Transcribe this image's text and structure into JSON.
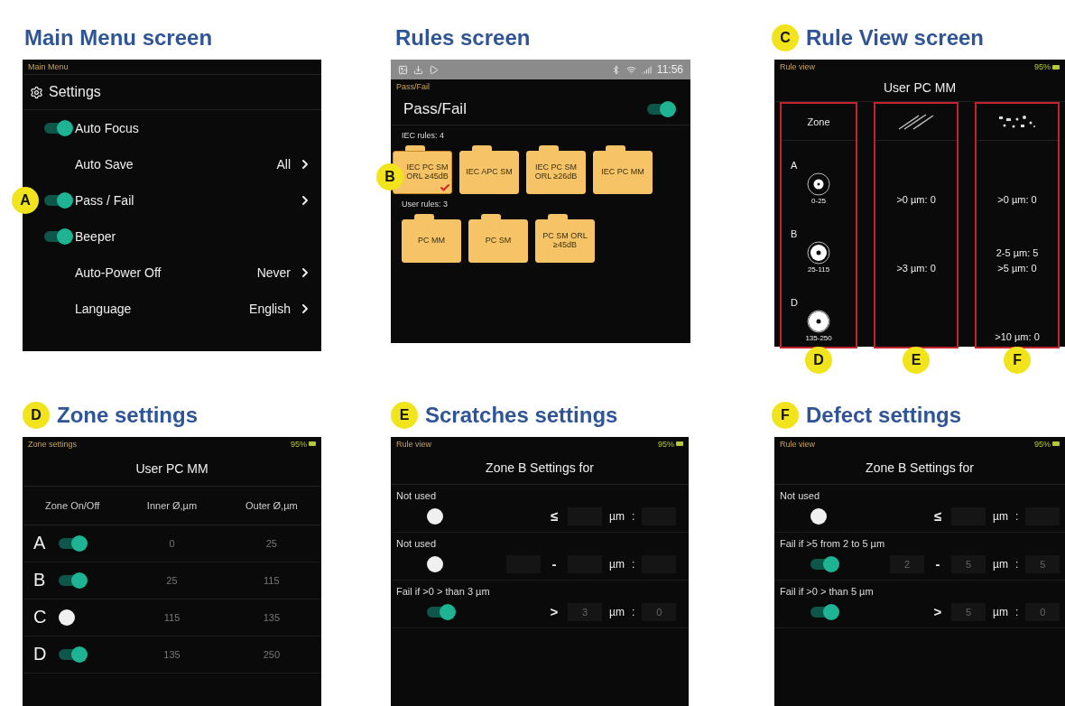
{
  "panels": [
    {
      "kind": "main_menu",
      "heading": "Main Menu screen",
      "title": "Main Menu",
      "header": "Settings",
      "items": [
        {
          "kind": "toggle",
          "label": "Auto Focus",
          "on": true
        },
        {
          "kind": "link",
          "label": "Auto Save",
          "value": "All"
        },
        {
          "kind": "toggle",
          "label": "Pass / Fail",
          "on": true,
          "callout": "A"
        },
        {
          "kind": "toggle",
          "label": "Beeper",
          "on": true
        },
        {
          "kind": "link",
          "label": "Auto-Power Off",
          "value": "Never"
        },
        {
          "kind": "link",
          "label": "Language",
          "value": "English"
        }
      ]
    },
    {
      "kind": "rules",
      "heading": "Rules screen",
      "clock": "11:56",
      "title": "Pass/Fail",
      "header": "Pass/Fail",
      "header_on": true,
      "groups": [
        {
          "label": "IEC rules: 4",
          "folders": [
            {
              "name": "IEC PC SM ORL ≥45dB",
              "selected": true,
              "callout": "B"
            },
            {
              "name": "IEC APC SM",
              "selected": false
            },
            {
              "name": "IEC PC SM ORL ≥26dB",
              "selected": false
            },
            {
              "name": "IEC PC MM",
              "selected": false
            }
          ]
        },
        {
          "label": "User rules: 3",
          "folders": [
            {
              "name": "PC MM",
              "selected": false
            },
            {
              "name": "PC SM",
              "selected": false
            },
            {
              "name": "PC SM ORL ≥45dB",
              "selected": false
            }
          ]
        }
      ]
    },
    {
      "kind": "rule_view",
      "badge": "C",
      "heading": "Rule View screen",
      "title": "Rule view",
      "battery": "95%",
      "header": "User PC MM",
      "zone_header": "Zone",
      "callouts": [
        "D",
        "E",
        "F"
      ],
      "zones": [
        {
          "letter": "A",
          "range": "0-25",
          "scratches": [
            ">0 µm: 0"
          ],
          "defects": [
            ">0 µm: 0"
          ]
        },
        {
          "letter": "B",
          "range": "25-115",
          "scratches": [
            ">3 µm: 0"
          ],
          "defects": [
            "2-5 µm: 5",
            ">5 µm: 0"
          ]
        },
        {
          "letter": "D",
          "range": "135-250",
          "defects": [
            ">10 µm: 0"
          ]
        }
      ]
    },
    {
      "kind": "zone_settings",
      "badge": "D",
      "heading": "Zone settings",
      "title": "Zone settings",
      "battery": "95%",
      "header": "User PC MM",
      "columns": [
        "Zone On/Off",
        "Inner Ø,µm",
        "Outer Ø,µm"
      ],
      "rows": [
        {
          "zone": "A",
          "on": true,
          "inner": "0",
          "outer": "25"
        },
        {
          "zone": "B",
          "on": true,
          "inner": "25",
          "outer": "115"
        },
        {
          "zone": "C",
          "on": false,
          "inner": "115",
          "outer": "135"
        },
        {
          "zone": "D",
          "on": true,
          "inner": "135",
          "outer": "250"
        }
      ]
    },
    {
      "kind": "threshold",
      "badge": "E",
      "heading": "Scratches settings",
      "title": "Rule view",
      "battery": "95%",
      "header": "Zone B Settings for",
      "rules": [
        {
          "label": "Not used",
          "on": false,
          "kind": "single",
          "operator": "≤",
          "unit": "µm",
          "separator": ":"
        },
        {
          "label": "Not used",
          "on": false,
          "kind": "range",
          "operator": "-",
          "unit": "µm",
          "separator": ":"
        },
        {
          "label": "Fail if >0  > than 3 µm",
          "on": true,
          "kind": "single",
          "operator": ">",
          "value": "3",
          "unit": "µm",
          "separator": ":",
          "count": "0"
        }
      ]
    },
    {
      "kind": "threshold",
      "badge": "F",
      "heading": "Defect settings",
      "title": "Rule view",
      "battery": "95%",
      "header": "Zone B Settings for",
      "rules": [
        {
          "label": "Not used",
          "on": false,
          "kind": "single",
          "operator": "≤",
          "unit": "µm",
          "separator": ":"
        },
        {
          "label": "Fail if >5  from 2 to 5 µm",
          "on": true,
          "kind": "range",
          "operator": "-",
          "from": "2",
          "to": "5",
          "unit": "µm",
          "separator": ":",
          "count": "5"
        },
        {
          "label": "Fail if >0  > than 5 µm",
          "on": true,
          "kind": "single",
          "operator": ">",
          "value": "5",
          "unit": "µm",
          "separator": ":",
          "count": "0"
        }
      ]
    }
  ]
}
